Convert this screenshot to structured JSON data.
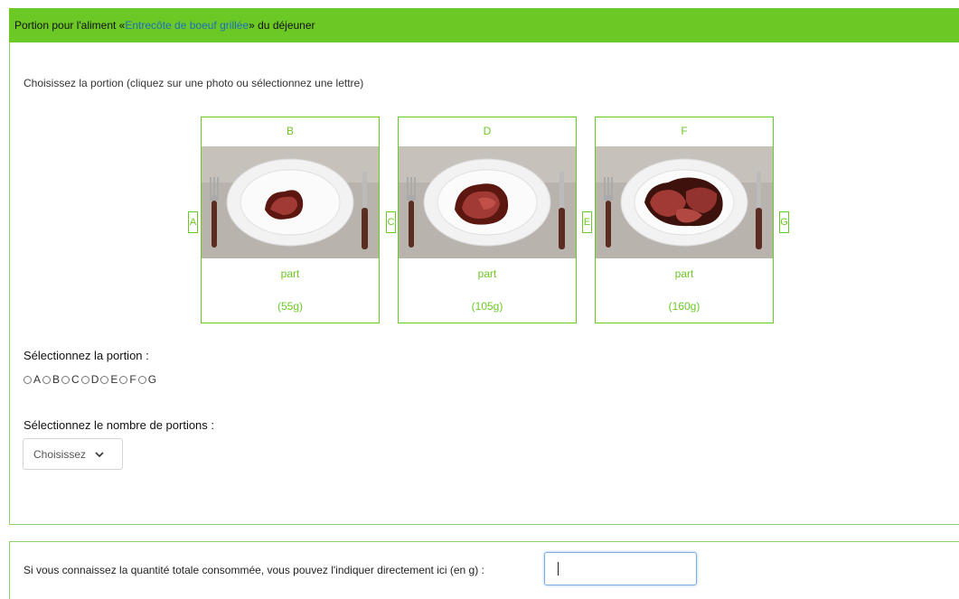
{
  "header": {
    "prefix": "Portion pour l'aliment « ",
    "food": "Entrecôte de boeuf grillée",
    "suffix": " » du déjeuner"
  },
  "instruction": "Choisissez la portion (cliquez sur une photo ou sélectionnez une lettre)",
  "side_letters": [
    "A",
    "C",
    "E",
    "G"
  ],
  "cards": [
    {
      "letter": "B",
      "label": "part",
      "weight": "(55g)"
    },
    {
      "letter": "D",
      "label": "part",
      "weight": "(105g)"
    },
    {
      "letter": "F",
      "label": "part",
      "weight": "(160g)"
    }
  ],
  "portion_label": "Sélectionnez la portion :",
  "radio_options": [
    "A",
    "B",
    "C",
    "D",
    "E",
    "F",
    "G"
  ],
  "count_label": "Sélectionnez le nombre de portions :",
  "count_select": {
    "value": "Choisissez"
  },
  "quantity": {
    "label": "Si vous connaissez la quantité totale consommée, vous pouvez l'indiquer directement ici (en g) :",
    "value": ""
  },
  "colors": {
    "accent": "#6cc825",
    "link": "#1d6fb8"
  }
}
